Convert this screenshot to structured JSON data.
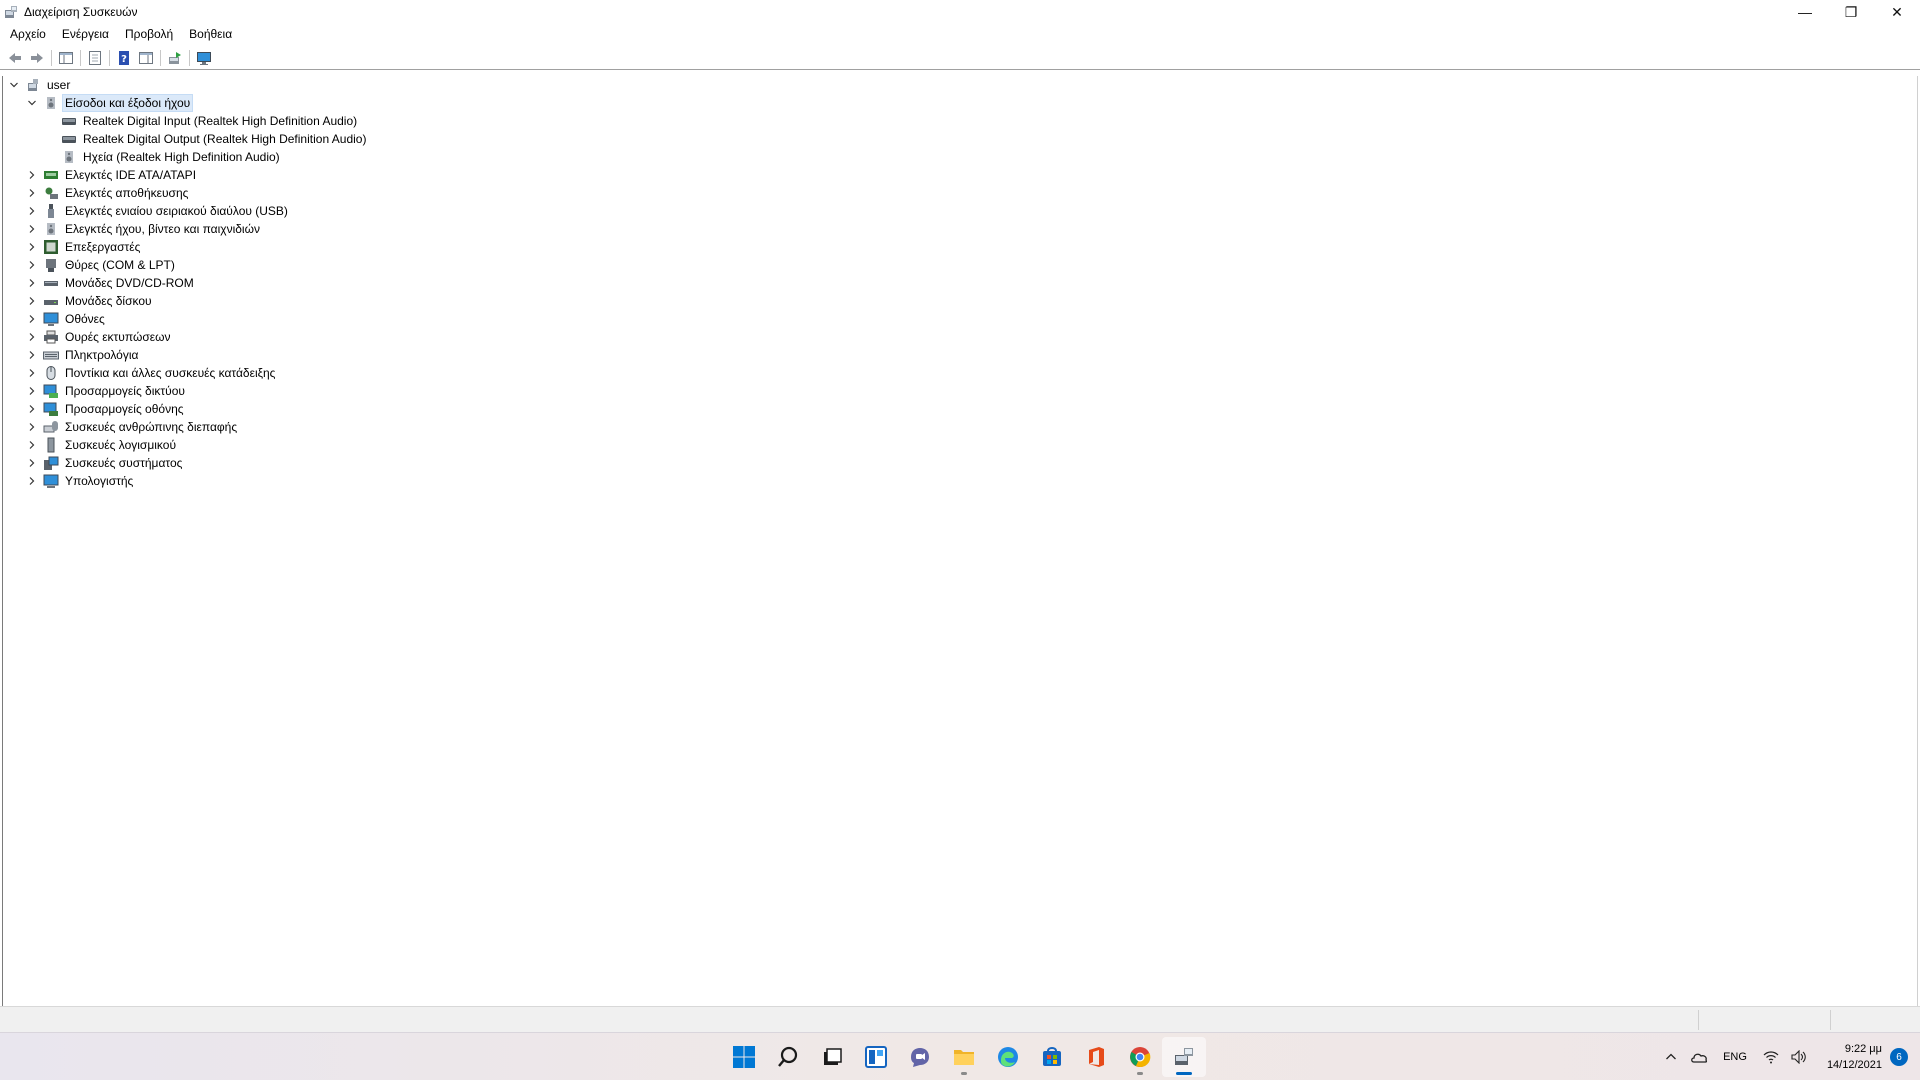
{
  "window": {
    "title": "Διαχείριση Συσκευών",
    "controls": {
      "minimize": "—",
      "restore": "❐",
      "close": "✕"
    }
  },
  "menu": [
    "Αρχείο",
    "Ενέργεια",
    "Προβολή",
    "Βοήθεια"
  ],
  "toolbar": [
    "back-icon",
    "forward-icon",
    "show-hide-console-tree-icon",
    "properties-icon",
    "help-icon",
    "action-pane-icon",
    "update-driver-icon",
    "monitor-icon"
  ],
  "tree": {
    "root": "user",
    "expanded_category": {
      "label": "Είσοδοι και έξοδοι ήχου",
      "children": [
        "Realtek Digital Input (Realtek High Definition Audio)",
        "Realtek Digital Output (Realtek High Definition Audio)",
        "Ηχεία (Realtek High Definition Audio)"
      ]
    },
    "categories": [
      "Ελεγκτές IDE ATA/ATAPI",
      "Ελεγκτές αποθήκευσης",
      "Ελεγκτές ενιαίου σειριακού διαύλου (USB)",
      "Ελεγκτές ήχου, βίντεο και παιχνιδιών",
      "Επεξεργαστές",
      "Θύρες (COM & LPT)",
      "Μονάδες DVD/CD-ROM",
      "Μονάδες δίσκου",
      "Οθόνες",
      "Ουρές εκτυπώσεων",
      "Πληκτρολόγια",
      "Ποντίκια και άλλες συσκευές κατάδειξης",
      "Προσαρμογείς δικτύου",
      "Προσαρμογείς οθόνης",
      "Συσκευές ανθρώπινης διεπαφής",
      "Συσκευές λογισμικού",
      "Συσκευές συστήματος",
      "Υπολογιστής"
    ]
  },
  "taskbar": {
    "apps": [
      "start-icon",
      "search-icon",
      "task-view-icon",
      "widgets-icon",
      "chat-icon",
      "file-explorer-icon",
      "edge-icon",
      "store-icon",
      "office-icon",
      "chrome-icon",
      "device-manager-icon"
    ],
    "tray": {
      "language": "ENG",
      "time": "9:22 μμ",
      "date": "14/12/2021",
      "notifications": "6"
    }
  },
  "colors": {
    "accent": "#0067c0",
    "selection": "#dbe9f9"
  }
}
